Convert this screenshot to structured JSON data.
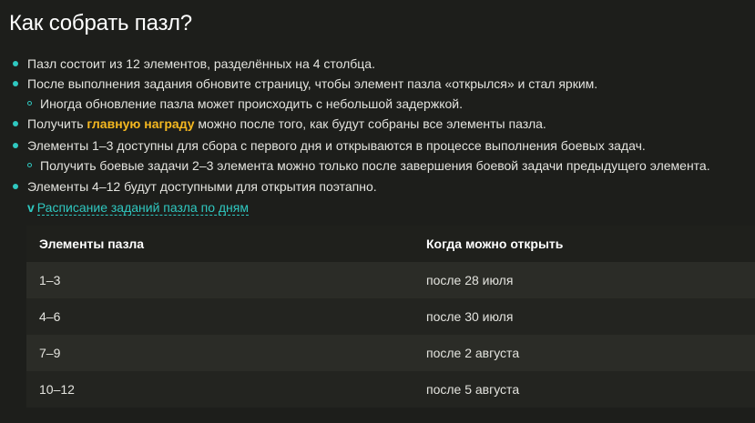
{
  "title": "Как собрать пазл?",
  "rules": [
    {
      "level": 1,
      "text": "Пазл состоит из 12 элементов, разделённых на 4 столбца."
    },
    {
      "level": 1,
      "text": "После выполнения задания обновите страницу, чтобы элемент пазла «открылся» и стал ярким."
    },
    {
      "level": 2,
      "text": "Иногда обновление пазла может происходить с небольшой задержкой."
    },
    {
      "level": 1,
      "pre": "Получить ",
      "highlight": "главную награду",
      "post": " можно после того, как будут собраны все элементы пазла."
    },
    {
      "level": 1,
      "text": "Элементы 1–3 доступны для сбора с первого дня и открываются в процессе выполнения боевых задач."
    },
    {
      "level": 2,
      "text": "Получить боевые задачи 2–3 элемента можно только после завершения боевой задачи предыдущего элемента."
    },
    {
      "level": 1,
      "text": "Элементы 4–12 будут доступными для открытия поэтапно."
    }
  ],
  "schedule_toggle": {
    "chevron": "v",
    "label": "Расписание заданий пазла по дням"
  },
  "table": {
    "headers": [
      "Элементы пазла",
      "Когда можно открыть"
    ],
    "rows": [
      [
        "1–3",
        "после 28 июля"
      ],
      [
        "4–6",
        "после 30 июля"
      ],
      [
        "7–9",
        "после 2 августа"
      ],
      [
        "10–12",
        "после 5 августа"
      ]
    ]
  },
  "colors": {
    "background": "#1d1e1b",
    "accent": "#2fc8c0",
    "highlight": "#f5b820"
  }
}
